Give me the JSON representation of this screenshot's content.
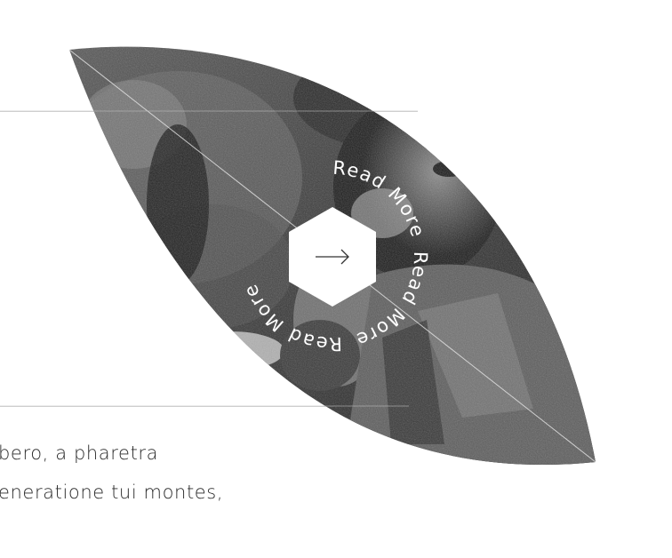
{
  "read_more": {
    "label": "Read More",
    "arrow": "→"
  },
  "excerpt": {
    "line_1": "bero, a pharetra",
    "line_2": "eneratione tui montes,"
  },
  "image": {
    "description_icon": "photo-icon"
  },
  "colors": {
    "rule": "#d6d6d6",
    "text": "#2b2b2b",
    "badge": "#ffffff",
    "arrow": "#333333"
  }
}
